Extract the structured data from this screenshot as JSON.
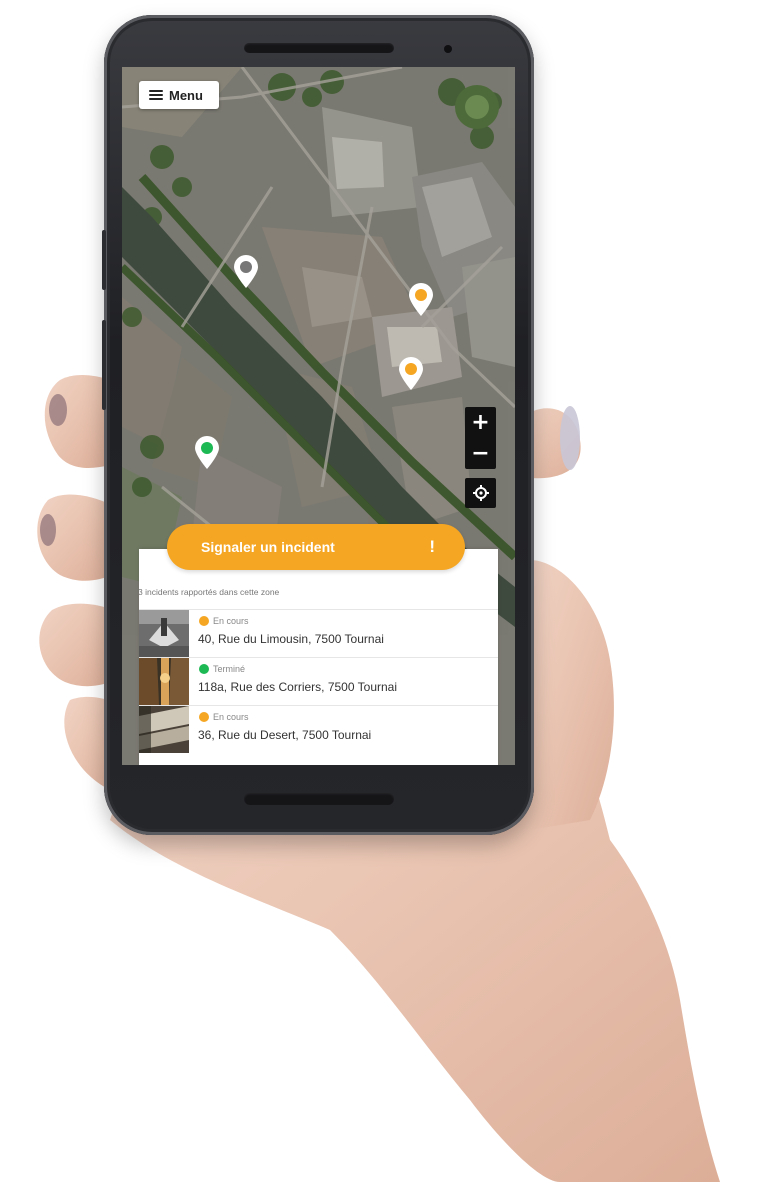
{
  "menu": {
    "label": "Menu",
    "icon": "hamburger-icon"
  },
  "map": {
    "type": "satellite",
    "markers": [
      {
        "status_color": "#e9e9e9",
        "icon": "map-pin-icon"
      },
      {
        "status_color": "#f5a623",
        "icon": "map-pin-icon"
      },
      {
        "status_color": "#f5a623",
        "icon": "map-pin-icon"
      },
      {
        "status_color": "#1db954",
        "icon": "map-pin-icon"
      }
    ],
    "controls": {
      "zoom_in": "+",
      "zoom_out": "−",
      "locate_icon": "crosshair-icon"
    }
  },
  "report_button": {
    "label": "Signaler un incident",
    "icon_text": "!"
  },
  "incident_count_text": "3 incidents rapportés dans cette zone",
  "incidents": [
    {
      "status": "En cours",
      "status_color": "#f5a623",
      "address": "40, Rue du Limousin, 7500 Tournai"
    },
    {
      "status": "Terminé",
      "status_color": "#1db954",
      "address": "118a, Rue des Corriers, 7500 Tournai"
    },
    {
      "status": "En cours",
      "status_color": "#f5a623",
      "address": "36, Rue du Desert, 7500 Tournai"
    }
  ],
  "colors": {
    "accent": "#f5a623",
    "done": "#1db954"
  }
}
